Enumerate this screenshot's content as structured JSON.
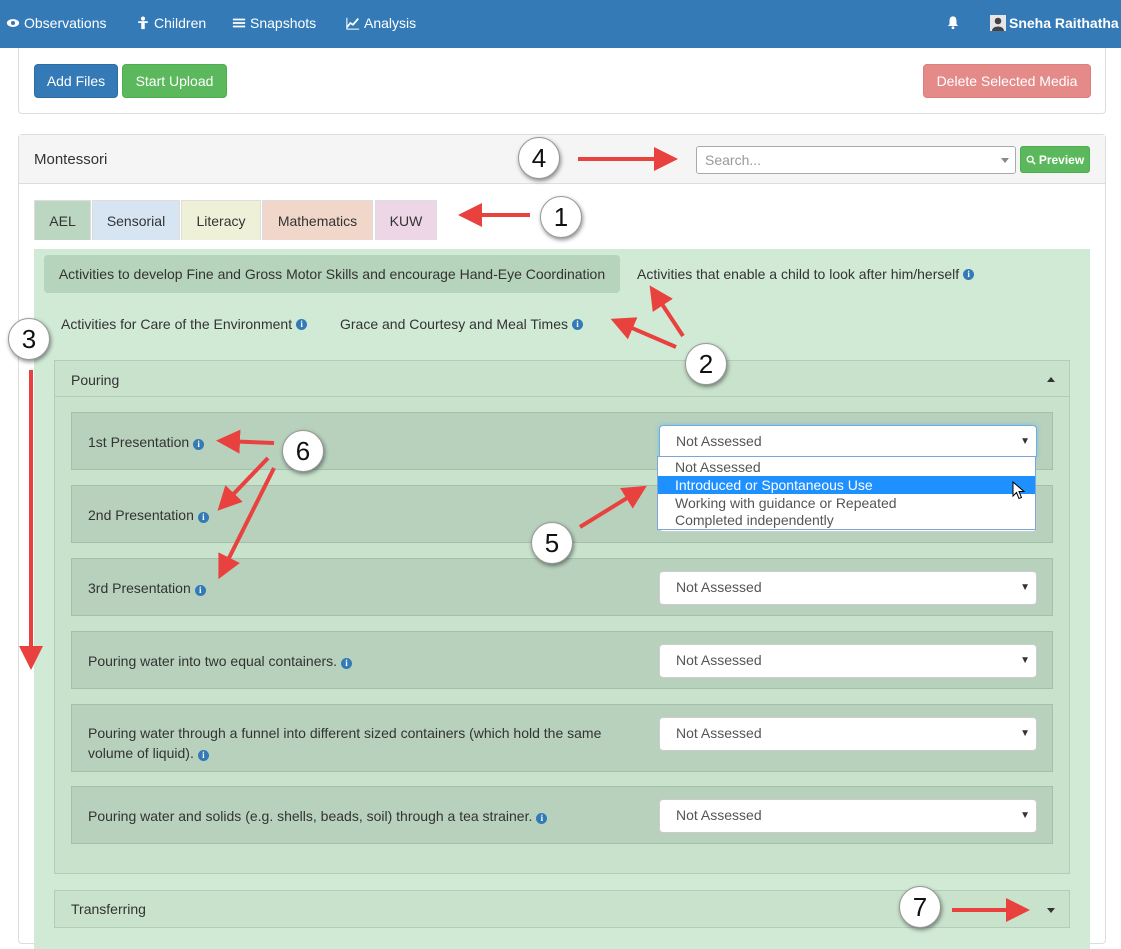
{
  "nav": {
    "items": [
      {
        "label": "Observations",
        "icon": "eye-icon"
      },
      {
        "label": "Children",
        "icon": "child-icon"
      },
      {
        "label": "Snapshots",
        "icon": "list-icon"
      },
      {
        "label": "Analysis",
        "icon": "line-chart-icon"
      }
    ],
    "bell_icon": "bell-icon",
    "user_name": "Sneha Raithatha",
    "bg_color": "#337ab7"
  },
  "upload": {
    "add_files": "Add Files",
    "start_upload": "Start Upload",
    "delete_selected": "Delete Selected Media"
  },
  "montessori": {
    "title": "Montessori",
    "search_placeholder": "Search...",
    "preview_label": "Preview",
    "tabs": [
      {
        "label": "AEL",
        "color": "#bcd7c1",
        "active": true
      },
      {
        "label": "Sensorial",
        "color": "#d7e5f3"
      },
      {
        "label": "Literacy",
        "color": "#eef0d8"
      },
      {
        "label": "Mathematics",
        "color": "#f1d7c9"
      },
      {
        "label": "KUW",
        "color": "#edd7e7"
      }
    ],
    "categories": [
      {
        "label": "Activities to develop Fine and Gross Motor Skills and encourage Hand-Eye Coordination",
        "active": true
      },
      {
        "label": "Activities that enable a child to look after him/herself"
      },
      {
        "label": "Activities for Care of the Environment"
      },
      {
        "label": "Grace and Courtesy and Meal Times"
      }
    ],
    "sections": [
      {
        "title": "Pouring",
        "expanded": true,
        "rows": [
          {
            "label": "1st Presentation",
            "value": "Not Assessed"
          },
          {
            "label": "2nd Presentation",
            "value": ""
          },
          {
            "label": "3rd Presentation",
            "value": "Not Assessed"
          },
          {
            "label": "Pouring water into two equal containers.",
            "value": "Not Assessed"
          },
          {
            "label": "Pouring water through a funnel into different sized containers (which hold the same volume of liquid).",
            "value": "Not Assessed"
          },
          {
            "label": "Pouring water and solids (e.g. shells, beads, soil) through a tea strainer.",
            "value": "Not Assessed"
          }
        ]
      },
      {
        "title": "Transferring",
        "expanded": false
      }
    ],
    "dropdown_options": [
      "Not Assessed",
      "Introduced or Spontaneous Use",
      "Working with guidance or Repeated",
      "Completed independently"
    ],
    "dropdown_highlighted": "Introduced or Spontaneous Use"
  },
  "annotations": [
    "1",
    "2",
    "3",
    "4",
    "5",
    "6",
    "7"
  ],
  "colors": {
    "green_bg": "#d1ead6",
    "arrow_red": "#e8413e",
    "highlight_blue": "#1e90ff"
  }
}
